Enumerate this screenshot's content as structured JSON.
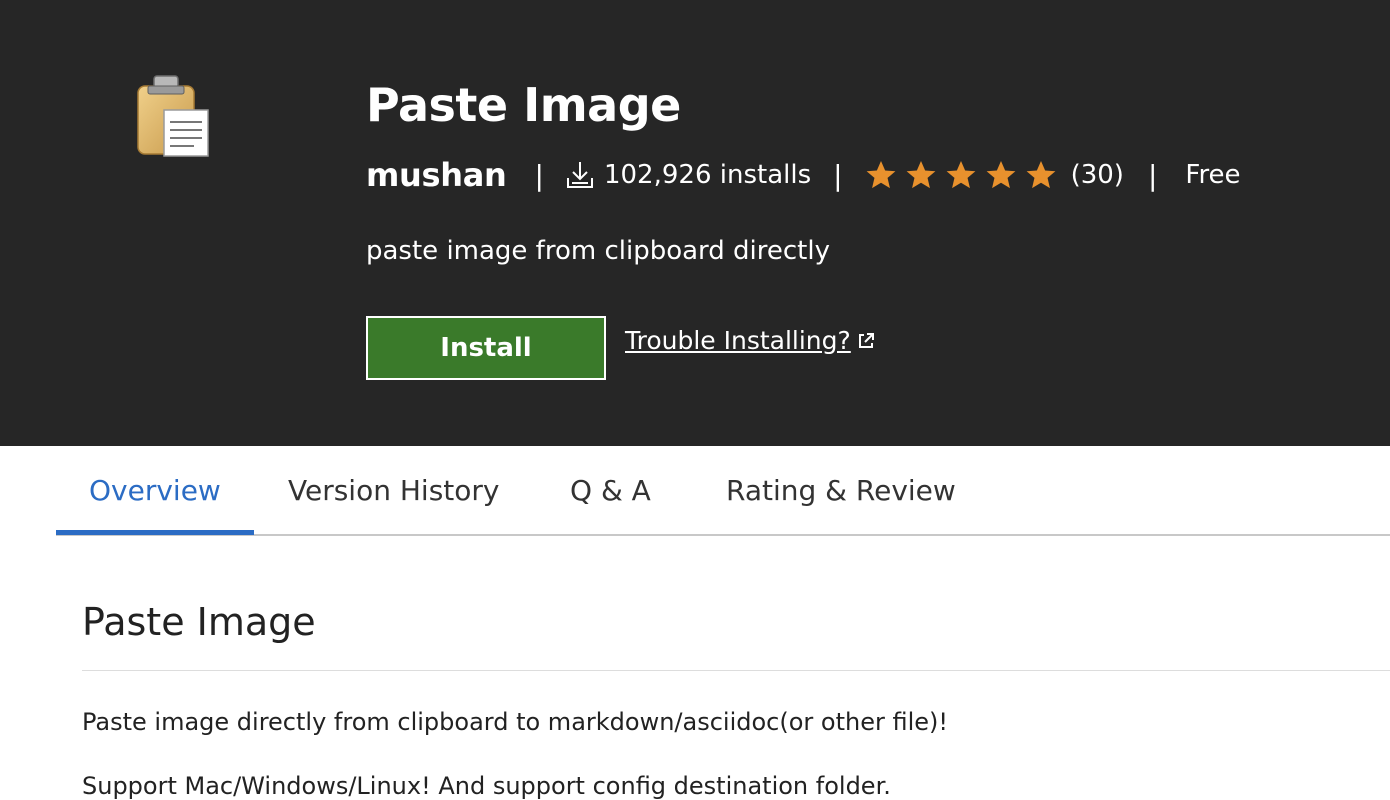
{
  "extension": {
    "name": "Paste Image",
    "icon": "clipboard-icon",
    "publisher": "mushan",
    "installs": "102,926 installs",
    "rating": {
      "stars": 5,
      "max_stars": 5,
      "count": "(30)",
      "star_color": "#e8912d"
    },
    "price": "Free",
    "short_description": "paste image from clipboard directly",
    "separator": "|"
  },
  "actions": {
    "install_label": "Install",
    "install_color": "#3a7a2a",
    "trouble_label": "Trouble Installing?"
  },
  "tabs": [
    {
      "label": "Overview",
      "active": true
    },
    {
      "label": "Version History",
      "active": false
    },
    {
      "label": "Q & A",
      "active": false
    },
    {
      "label": "Rating & Review",
      "active": false
    }
  ],
  "overview": {
    "heading": "Paste Image",
    "paragraph": "Paste image directly from clipboard to markdown/asciidoc(or other file)!",
    "next_line_partial": "Support Mac/Windows/Linux! And support config destination folder."
  },
  "colors": {
    "hero_background": "#262626",
    "accent": "#2b6cc4"
  }
}
